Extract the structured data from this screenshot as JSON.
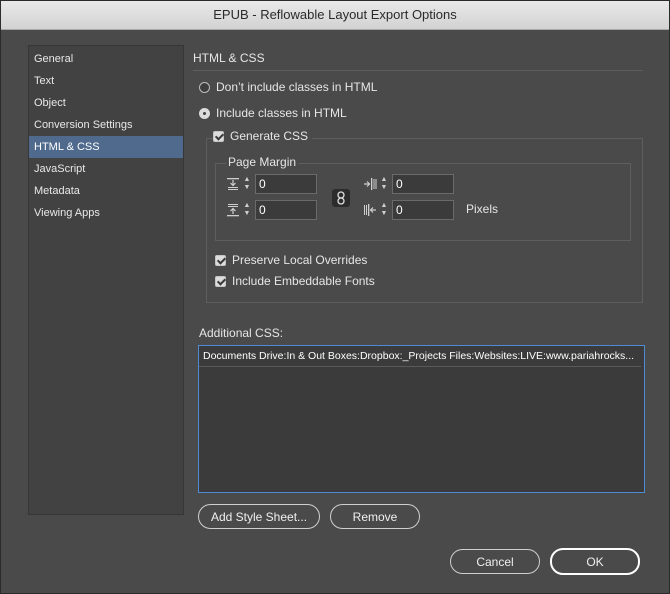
{
  "window": {
    "title": "EPUB - Reflowable Layout Export Options"
  },
  "sidebar": {
    "items": [
      {
        "label": "General"
      },
      {
        "label": "Text"
      },
      {
        "label": "Object"
      },
      {
        "label": "Conversion Settings"
      },
      {
        "label": "HTML & CSS",
        "selected": true
      },
      {
        "label": "JavaScript"
      },
      {
        "label": "Metadata"
      },
      {
        "label": "Viewing Apps"
      }
    ]
  },
  "html_css": {
    "section_title": "HTML & CSS",
    "radio_no_classes": "Don’t include classes in HTML",
    "radio_classes": "Include classes in HTML",
    "generate_css": "Generate CSS",
    "page_margin_label": "Page Margin",
    "margin_top": "0",
    "margin_bottom": "0",
    "margin_left": "0",
    "margin_right": "0",
    "pixels_label": "Pixels",
    "preserve_overrides": "Preserve Local Overrides",
    "include_fonts": "Include Embeddable Fonts",
    "additional_css_label": "Additional CSS:",
    "css_files": [
      "Documents Drive:In & Out Boxes:Dropbox:_Projects Files:Websites:LIVE:www.pariahrocks..."
    ]
  },
  "buttons": {
    "add_style_sheet": "Add Style Sheet...",
    "remove": "Remove",
    "cancel": "Cancel",
    "ok": "OK"
  }
}
